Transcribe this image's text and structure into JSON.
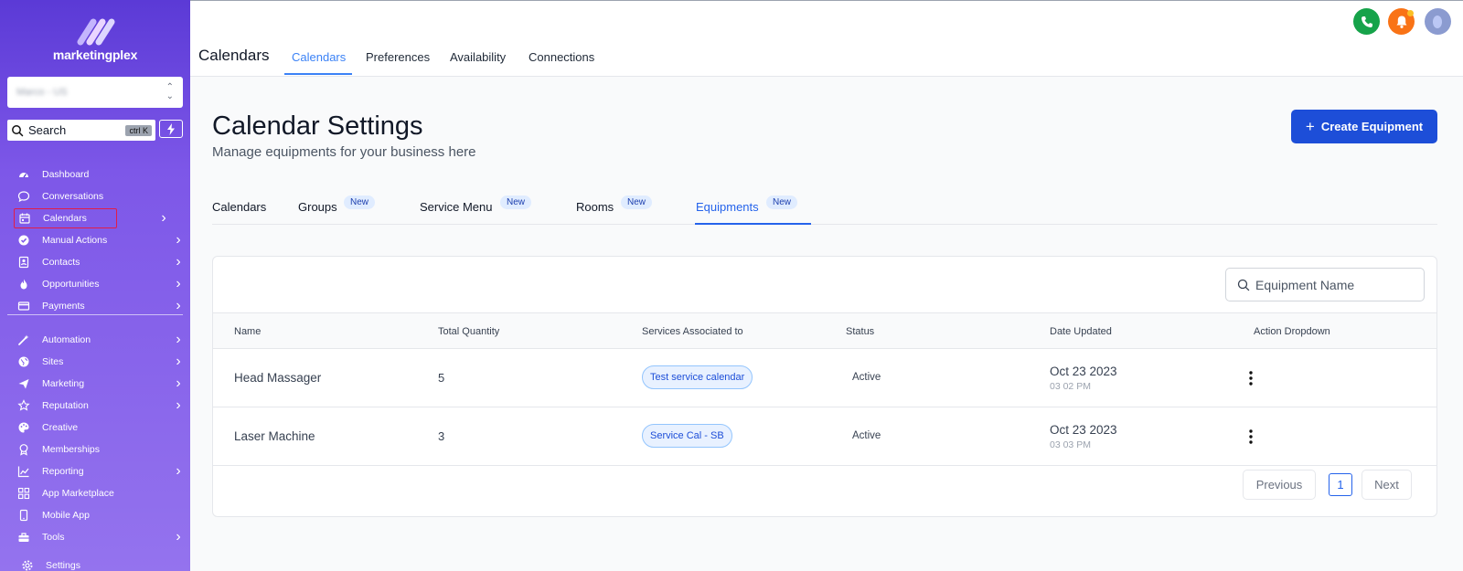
{
  "sidebar": {
    "brand": "marketingplex",
    "account_name": "Marco - US",
    "search_label": "Search",
    "search_shortcut": "ctrl K",
    "items": [
      {
        "label": "Dashboard",
        "icon": "dashboard-icon",
        "chevron": false
      },
      {
        "label": "Conversations",
        "icon": "chat-bubble-icon",
        "chevron": false
      },
      {
        "label": "Calendars",
        "icon": "calendar-icon",
        "chevron": true,
        "active": true
      },
      {
        "label": "Manual Actions",
        "icon": "check-circle-icon",
        "chevron": true
      },
      {
        "label": "Contacts",
        "icon": "contact-card-icon",
        "chevron": true
      },
      {
        "label": "Opportunities",
        "icon": "flame-icon",
        "chevron": true
      },
      {
        "label": "Payments",
        "icon": "credit-card-icon",
        "chevron": true
      },
      {
        "label": "Automation",
        "icon": "magic-wand-icon",
        "chevron": true
      },
      {
        "label": "Sites",
        "icon": "globe-icon",
        "chevron": true
      },
      {
        "label": "Marketing",
        "icon": "paper-plane-icon",
        "chevron": true
      },
      {
        "label": "Reputation",
        "icon": "star-icon",
        "chevron": true
      },
      {
        "label": "Creative",
        "icon": "palette-icon",
        "chevron": false
      },
      {
        "label": "Memberships",
        "icon": "award-icon",
        "chevron": false
      },
      {
        "label": "Reporting",
        "icon": "chart-icon",
        "chevron": true
      },
      {
        "label": "App Marketplace",
        "icon": "grid-icon",
        "chevron": false
      },
      {
        "label": "Mobile App",
        "icon": "mobile-icon",
        "chevron": false
      },
      {
        "label": "Tools",
        "icon": "toolbox-icon",
        "chevron": true
      },
      {
        "label": "Settings",
        "icon": "gear-icon",
        "chevron": false
      }
    ]
  },
  "topbar": {
    "title": "Calendars",
    "tabs": [
      "Calendars",
      "Preferences",
      "Availability",
      "Connections"
    ],
    "active_tab": 0
  },
  "main": {
    "title": "Calendar Settings",
    "subtitle": "Manage equipments for your business here",
    "create_button": "Create Equipment",
    "sub_tabs": [
      {
        "label": "Calendars",
        "badge": ""
      },
      {
        "label": "Groups",
        "badge": "New"
      },
      {
        "label": "Service Menu",
        "badge": "New"
      },
      {
        "label": "Rooms",
        "badge": "New"
      },
      {
        "label": "Equipments",
        "badge": "New",
        "active": true
      }
    ],
    "search_placeholder": "Equipment Name",
    "columns": [
      "Name",
      "Total Quantity",
      "Services Associated to",
      "Status",
      "Date Updated",
      "Action Dropdown"
    ],
    "rows": [
      {
        "name": "Head Massager",
        "quantity": "5",
        "service": "Test service calendar",
        "status": "Active",
        "date": "Oct 23 2023",
        "time": "03 02 PM"
      },
      {
        "name": "Laser Machine",
        "quantity": "3",
        "service": "Service Cal - SB",
        "status": "Active",
        "date": "Oct 23 2023",
        "time": "03 03 PM"
      }
    ],
    "pagination": {
      "previous": "Previous",
      "page": "1",
      "next": "Next"
    }
  },
  "colors": {
    "accent": "#2563eb",
    "primary_button": "#1d4ed8",
    "sidebar_top": "#5b3ad6",
    "sidebar_bottom": "#9473ee",
    "phone": "#16a34a",
    "bell": "#f97316"
  }
}
